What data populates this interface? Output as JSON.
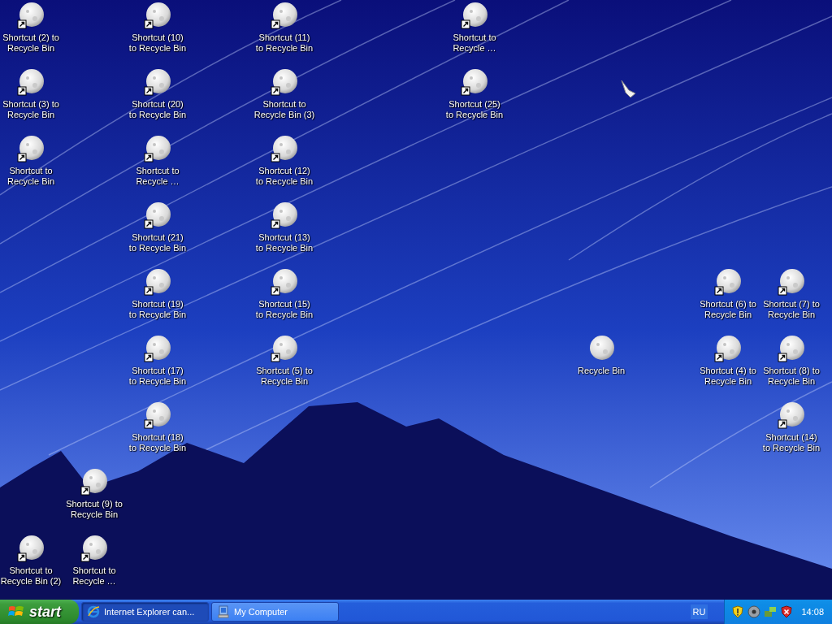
{
  "desktop_icons": [
    {
      "label": "Shortcut (2) to\nRecycle Bin",
      "shortcut": true
    },
    {
      "label": "Shortcut (10)\nto Recycle Bin",
      "shortcut": true
    },
    {
      "label": "Shortcut (11)\nto Recycle Bin",
      "shortcut": true
    },
    {
      "label": "Shortcut to\nRecycle …",
      "shortcut": true
    },
    {
      "label": "Shortcut (3) to\nRecycle Bin",
      "shortcut": true
    },
    {
      "label": "Shortcut (20)\nto Recycle Bin",
      "shortcut": true
    },
    {
      "label": "Shortcut to\nRecycle Bin (3)",
      "shortcut": true
    },
    {
      "label": "Shortcut (25)\nto Recycle Bin",
      "shortcut": true
    },
    {
      "label": "Shortcut to\nRecycle Bin",
      "shortcut": true
    },
    {
      "label": "Shortcut to\nRecycle …",
      "shortcut": true
    },
    {
      "label": "Shortcut (12)\nto Recycle Bin",
      "shortcut": true
    },
    {
      "label": "Shortcut (21)\nto Recycle Bin",
      "shortcut": true
    },
    {
      "label": "Shortcut (13)\nto Recycle Bin",
      "shortcut": true
    },
    {
      "label": "Shortcut (19)\nto Recycle Bin",
      "shortcut": true
    },
    {
      "label": "Shortcut (15)\nto Recycle Bin",
      "shortcut": true
    },
    {
      "label": "Shortcut (6) to\nRecycle Bin",
      "shortcut": true
    },
    {
      "label": "Shortcut (7) to\nRecycle Bin",
      "shortcut": true
    },
    {
      "label": "Shortcut (17)\nto Recycle Bin",
      "shortcut": true
    },
    {
      "label": "Shortcut (5) to\nRecycle Bin",
      "shortcut": true
    },
    {
      "label": "Recycle Bin",
      "shortcut": false
    },
    {
      "label": "Shortcut (4) to\nRecycle Bin",
      "shortcut": true
    },
    {
      "label": "Shortcut (8) to\nRecycle Bin",
      "shortcut": true
    },
    {
      "label": "Shortcut (18)\nto Recycle Bin",
      "shortcut": true
    },
    {
      "label": "Shortcut (14)\nto Recycle Bin",
      "shortcut": true
    },
    {
      "label": "Shortcut (9) to\nRecycle Bin",
      "shortcut": true
    },
    {
      "label": "Shortcut to\nRecycle Bin (2)",
      "shortcut": true
    },
    {
      "label": "Shortcut to\nRecycle …",
      "shortcut": true
    }
  ],
  "taskbar": {
    "start": "start",
    "tasks": [
      {
        "label": "Internet Explorer can...",
        "selected": true,
        "kind": "browser"
      },
      {
        "label": "My Computer",
        "selected": false,
        "kind": "computer"
      }
    ],
    "language": "RU",
    "clock": "14:08"
  }
}
